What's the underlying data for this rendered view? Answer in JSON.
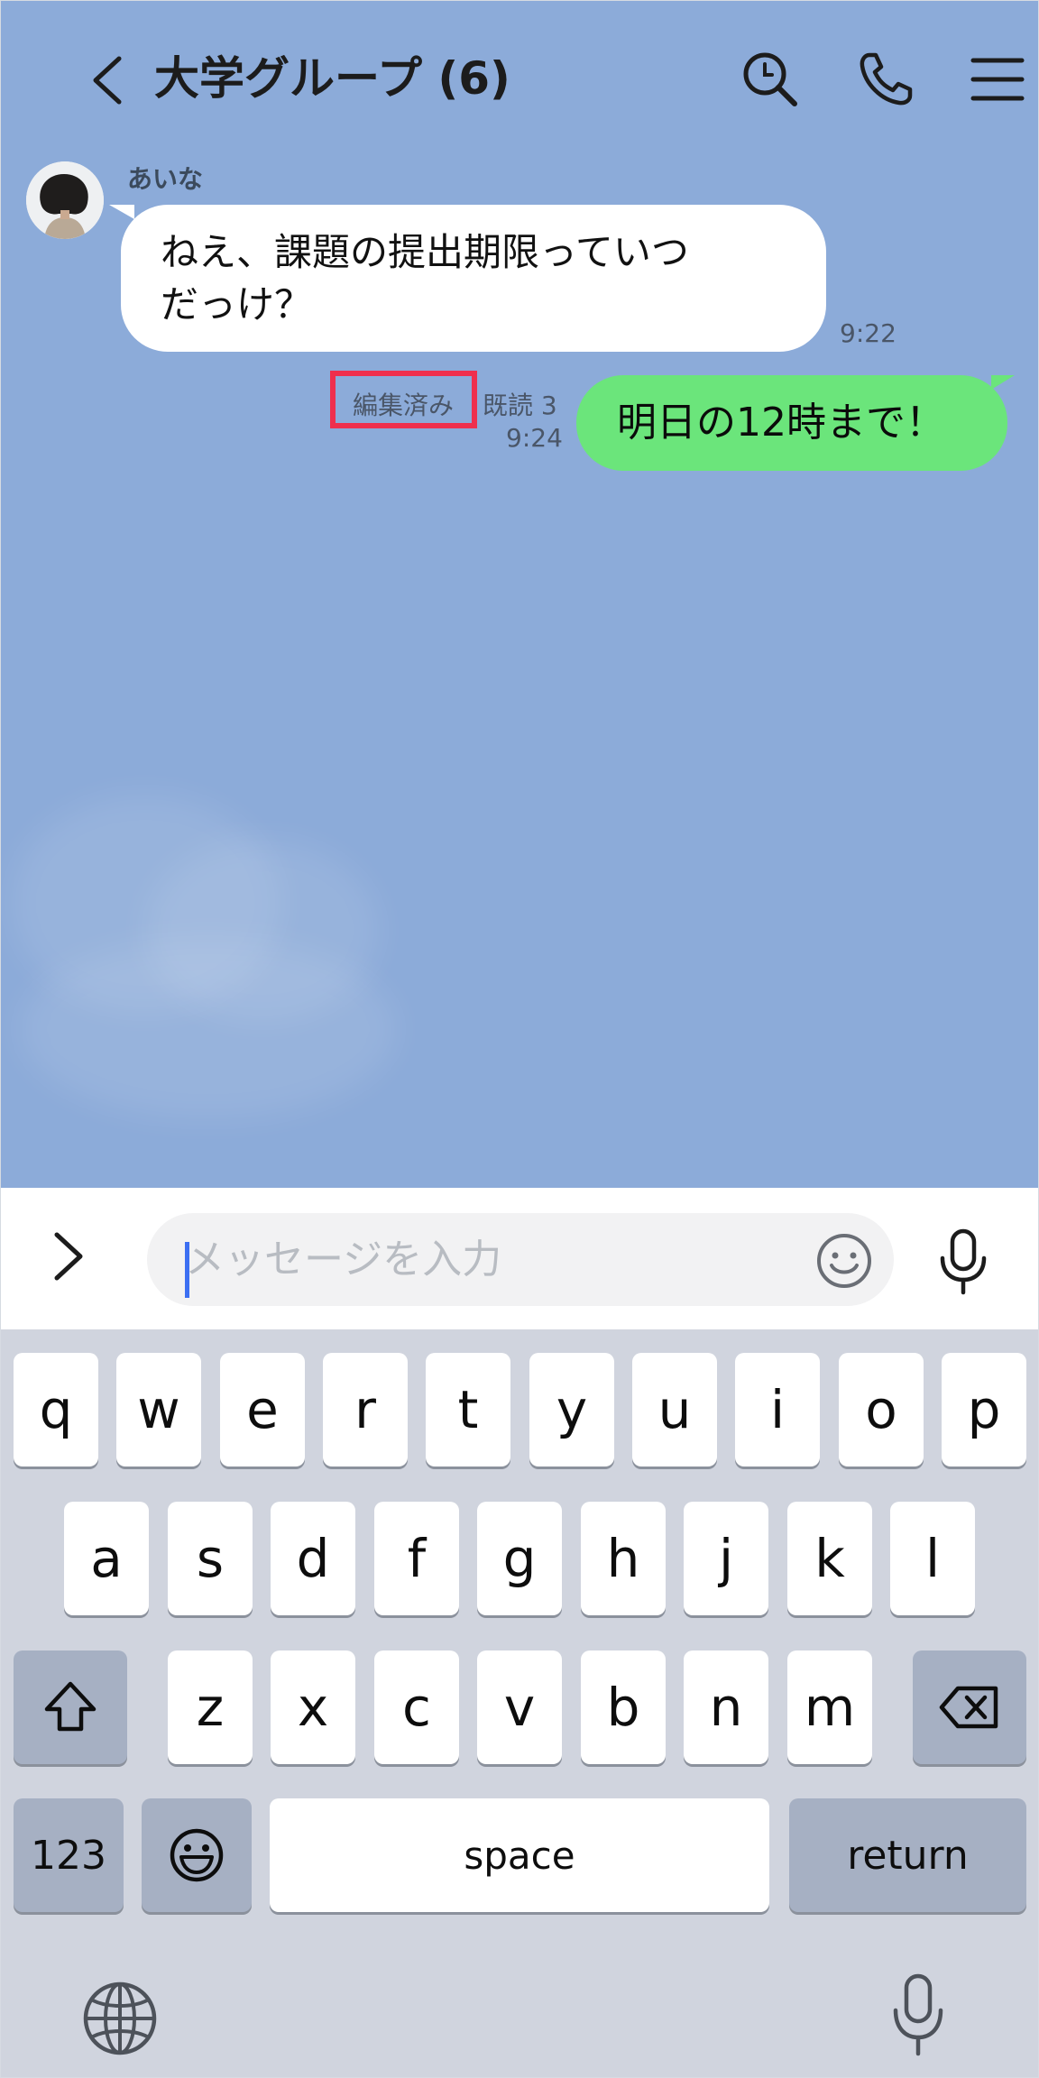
{
  "header": {
    "title": "大学グループ (6)",
    "icons": [
      "back-icon",
      "search-icon",
      "phone-icon",
      "menu-icon"
    ]
  },
  "messages": [
    {
      "direction": "incoming",
      "sender": "あいな",
      "text_line1": "ねえ、課題の提出期限っていつ",
      "text_line2": "だっけ？",
      "time": "9:22"
    },
    {
      "direction": "outgoing",
      "text": "明日の12時まで！",
      "edited_label": "編集済み",
      "read_label": "既読 3",
      "time": "9:24"
    }
  ],
  "input": {
    "placeholder": "メッセージを入力",
    "icons": [
      "expand-icon",
      "emoji-icon",
      "microphone-icon"
    ]
  },
  "keyboard": {
    "row1": [
      "q",
      "w",
      "e",
      "r",
      "t",
      "y",
      "u",
      "i",
      "o",
      "p"
    ],
    "row2": [
      "a",
      "s",
      "d",
      "f",
      "g",
      "h",
      "j",
      "k",
      "l"
    ],
    "row3": [
      "z",
      "x",
      "c",
      "v",
      "b",
      "n",
      "m"
    ],
    "numbers_label": "123",
    "space_label": "space",
    "return_label": "return",
    "icons": [
      "shift-icon",
      "backspace-icon",
      "emoji-key-icon",
      "globe-icon",
      "dictation-icon"
    ]
  },
  "colors": {
    "chat_background": "#8cabd9",
    "outgoing_bubble": "#6be57b",
    "incoming_bubble": "#ffffff",
    "highlight_box": "#ef2f4d",
    "cursor": "#3c6ff2"
  }
}
